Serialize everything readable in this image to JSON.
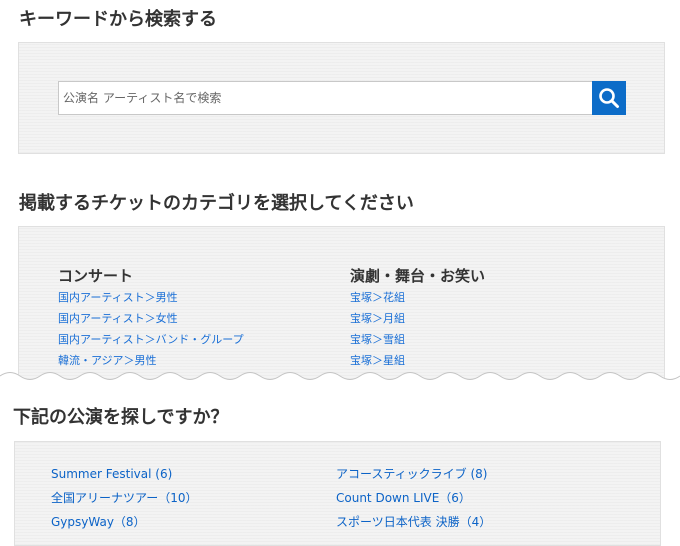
{
  "keyword_section": {
    "title": "キーワードから検索する",
    "search": {
      "placeholder": "公演名 アーティスト名で検索",
      "value": "",
      "button_icon": "search-icon"
    }
  },
  "category_section": {
    "title": "掲載するチケットのカテゴリを選択してください",
    "columns": [
      {
        "title": "コンサート",
        "items": [
          "国内アーティスト＞男性",
          "国内アーティスト＞女性",
          "国内アーティスト＞バンド・グループ",
          "韓流・アジア＞男性"
        ]
      },
      {
        "title": "演劇・舞台・お笑い",
        "items": [
          "宝塚＞花組",
          "宝塚＞月組",
          "宝塚＞雪組",
          "宝塚＞星組"
        ]
      }
    ]
  },
  "suggest_section": {
    "title": "下記の公演を探しですか？",
    "items": [
      "Summer Festival (6)",
      "アコースティックライブ (8)",
      "全国アリーナツアー（10）",
      "Count Down LIVE（6）",
      "GypsyWay（8）",
      "スポーツ日本代表 決勝（4）"
    ]
  },
  "colors": {
    "accent": "#0c6cc8",
    "link": "#1a6fd6",
    "panel": "#f3f3f3",
    "heading": "#333333"
  }
}
